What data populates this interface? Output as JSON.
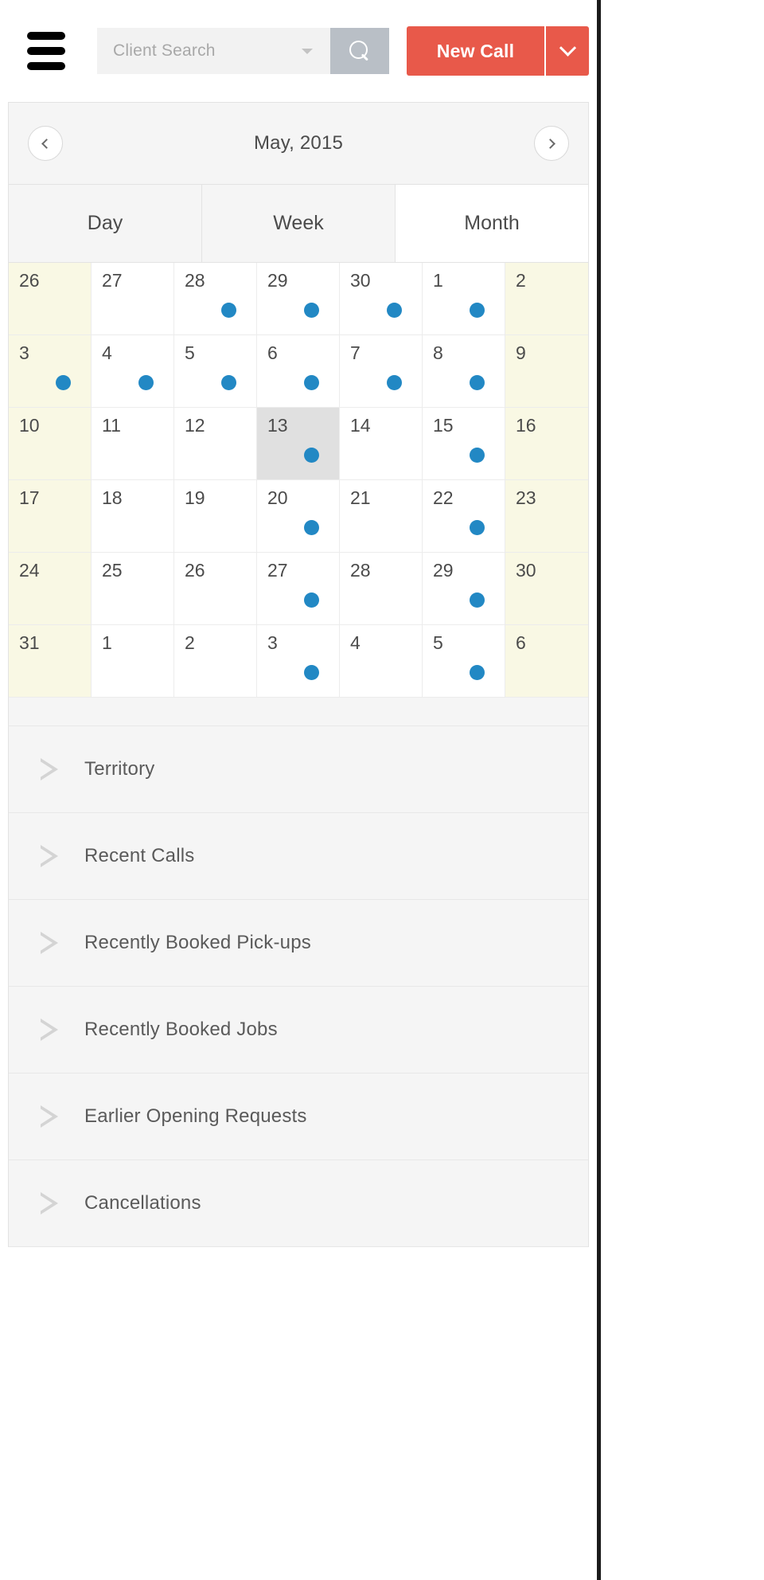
{
  "header": {
    "menu_icon": "hamburger-icon",
    "search": {
      "placeholder": "Client Search",
      "value": "",
      "dropdown_icon": "chevron-down-icon",
      "button_icon": "search-icon"
    },
    "new_call": {
      "label": "New Call",
      "dropdown_icon": "chevron-down-icon",
      "color": "#e8594a"
    }
  },
  "calendar": {
    "prev_icon": "chevron-left-icon",
    "next_icon": "chevron-right-icon",
    "title": "May, 2015",
    "tabs": [
      {
        "label": "Day",
        "active": false
      },
      {
        "label": "Week",
        "active": false
      },
      {
        "label": "Month",
        "active": true
      }
    ],
    "dot_color": "#2288c4",
    "weekend_color": "#f9f8e4",
    "selected_color": "#e0e0e0",
    "weeks": [
      [
        {
          "day": "26",
          "weekend": true,
          "dot": false,
          "selected": false
        },
        {
          "day": "27",
          "weekend": false,
          "dot": false,
          "selected": false
        },
        {
          "day": "28",
          "weekend": false,
          "dot": true,
          "selected": false
        },
        {
          "day": "29",
          "weekend": false,
          "dot": true,
          "selected": false
        },
        {
          "day": "30",
          "weekend": false,
          "dot": true,
          "selected": false
        },
        {
          "day": "1",
          "weekend": false,
          "dot": true,
          "selected": false
        },
        {
          "day": "2",
          "weekend": true,
          "dot": false,
          "selected": false
        }
      ],
      [
        {
          "day": "3",
          "weekend": true,
          "dot": true,
          "selected": false
        },
        {
          "day": "4",
          "weekend": false,
          "dot": true,
          "selected": false
        },
        {
          "day": "5",
          "weekend": false,
          "dot": true,
          "selected": false
        },
        {
          "day": "6",
          "weekend": false,
          "dot": true,
          "selected": false
        },
        {
          "day": "7",
          "weekend": false,
          "dot": true,
          "selected": false
        },
        {
          "day": "8",
          "weekend": false,
          "dot": true,
          "selected": false
        },
        {
          "day": "9",
          "weekend": true,
          "dot": false,
          "selected": false
        }
      ],
      [
        {
          "day": "10",
          "weekend": true,
          "dot": false,
          "selected": false
        },
        {
          "day": "11",
          "weekend": false,
          "dot": false,
          "selected": false
        },
        {
          "day": "12",
          "weekend": false,
          "dot": false,
          "selected": false
        },
        {
          "day": "13",
          "weekend": false,
          "dot": true,
          "selected": true
        },
        {
          "day": "14",
          "weekend": false,
          "dot": false,
          "selected": false
        },
        {
          "day": "15",
          "weekend": false,
          "dot": true,
          "selected": false
        },
        {
          "day": "16",
          "weekend": true,
          "dot": false,
          "selected": false
        }
      ],
      [
        {
          "day": "17",
          "weekend": true,
          "dot": false,
          "selected": false
        },
        {
          "day": "18",
          "weekend": false,
          "dot": false,
          "selected": false
        },
        {
          "day": "19",
          "weekend": false,
          "dot": false,
          "selected": false
        },
        {
          "day": "20",
          "weekend": false,
          "dot": true,
          "selected": false
        },
        {
          "day": "21",
          "weekend": false,
          "dot": false,
          "selected": false
        },
        {
          "day": "22",
          "weekend": false,
          "dot": true,
          "selected": false
        },
        {
          "day": "23",
          "weekend": true,
          "dot": false,
          "selected": false
        }
      ],
      [
        {
          "day": "24",
          "weekend": true,
          "dot": false,
          "selected": false
        },
        {
          "day": "25",
          "weekend": false,
          "dot": false,
          "selected": false
        },
        {
          "day": "26",
          "weekend": false,
          "dot": false,
          "selected": false
        },
        {
          "day": "27",
          "weekend": false,
          "dot": true,
          "selected": false
        },
        {
          "day": "28",
          "weekend": false,
          "dot": false,
          "selected": false
        },
        {
          "day": "29",
          "weekend": false,
          "dot": true,
          "selected": false
        },
        {
          "day": "30",
          "weekend": true,
          "dot": false,
          "selected": false
        }
      ],
      [
        {
          "day": "31",
          "weekend": true,
          "dot": false,
          "selected": false
        },
        {
          "day": "1",
          "weekend": false,
          "dot": false,
          "selected": false
        },
        {
          "day": "2",
          "weekend": false,
          "dot": false,
          "selected": false
        },
        {
          "day": "3",
          "weekend": false,
          "dot": true,
          "selected": false
        },
        {
          "day": "4",
          "weekend": false,
          "dot": false,
          "selected": false
        },
        {
          "day": "5",
          "weekend": false,
          "dot": true,
          "selected": false
        },
        {
          "day": "6",
          "weekend": true,
          "dot": false,
          "selected": false
        }
      ]
    ]
  },
  "accordion": {
    "expand_icon": "triangle-right-icon",
    "items": [
      {
        "label": "Territory"
      },
      {
        "label": "Recent Calls"
      },
      {
        "label": "Recently Booked Pick-ups"
      },
      {
        "label": "Recently Booked Jobs"
      },
      {
        "label": "Earlier Opening Requests"
      },
      {
        "label": "Cancellations"
      }
    ]
  }
}
